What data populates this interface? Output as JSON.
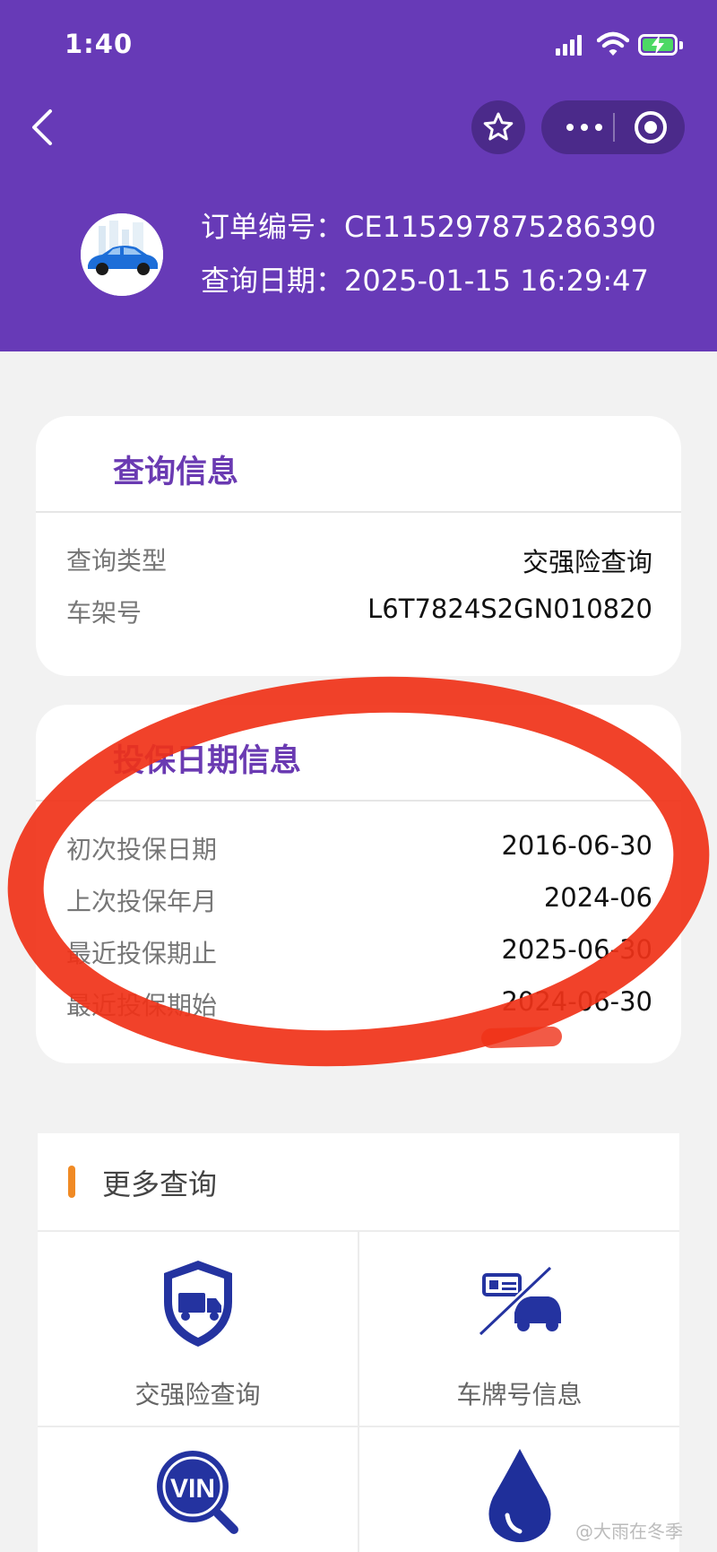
{
  "status_bar": {
    "time": "1:40",
    "icons": [
      "cellular-signal-icon",
      "wifi-icon",
      "battery-charging-icon"
    ]
  },
  "nav": {
    "icons": [
      "back-chevron-icon",
      "star-icon",
      "more-dots-icon",
      "target-icon"
    ]
  },
  "order": {
    "number_label": "订单编号：",
    "number_value": "CE115297875286390",
    "date_label": "查询日期：",
    "date_value": "2025-01-15 16:29:47"
  },
  "query_info": {
    "title": "查询信息",
    "rows": [
      {
        "label": "查询类型",
        "value": "交强险查询"
      },
      {
        "label": "车架号",
        "value": "L6T7824S2GN010820"
      }
    ]
  },
  "insurance_info": {
    "title": "投保日期信息",
    "rows": [
      {
        "label": "初次投保日期",
        "value": "2016-06-30"
      },
      {
        "label": "上次投保年月",
        "value": "2024-06"
      },
      {
        "label": "最近投保期止",
        "value": "2025-06-30"
      },
      {
        "label": "最近投保期始",
        "value": "2024-06-30"
      }
    ]
  },
  "more_query": {
    "title": "更多查询",
    "items": [
      {
        "label": "交强险查询",
        "icon": "shield-truck-icon"
      },
      {
        "label": "车牌号信息",
        "icon": "license-plate-car-icon"
      },
      {
        "label": "",
        "icon": "vin-search-icon"
      },
      {
        "label": "",
        "icon": "oil-drop-icon"
      }
    ]
  },
  "watermark": "@大雨在冬季",
  "colors": {
    "header": "#673ab7",
    "title": "#6a3ab2",
    "accent": "#f08a24",
    "icon_blue": "#2433a0",
    "annotation_red": "#f03218"
  }
}
